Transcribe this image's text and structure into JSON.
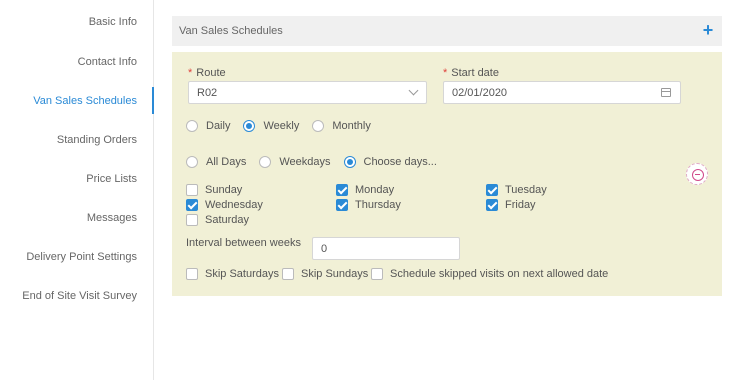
{
  "sidebar": {
    "items": [
      {
        "label": "Basic Info",
        "active": false
      },
      {
        "label": "Contact Info",
        "active": false
      },
      {
        "label": "Van Sales Schedules",
        "active": true
      },
      {
        "label": "Standing Orders",
        "active": false
      },
      {
        "label": "Price Lists",
        "active": false
      },
      {
        "label": "Messages",
        "active": false
      },
      {
        "label": "Delivery Point Settings",
        "active": false
      },
      {
        "label": "End of Site Visit Survey",
        "active": false
      }
    ]
  },
  "section": {
    "title": "Van Sales Schedules",
    "add_icon": "plus-icon",
    "add_symbol": "+"
  },
  "form": {
    "required_mark": "*",
    "route": {
      "label": "Route",
      "value": "R02"
    },
    "start_date": {
      "label": "Start date",
      "value": "02/01/2020"
    },
    "frequency": {
      "options": [
        "Daily",
        "Weekly",
        "Monthly"
      ],
      "selected": "Weekly"
    },
    "day_mode": {
      "options": [
        "All Days",
        "Weekdays",
        "Choose days..."
      ],
      "selected": "Choose days..."
    },
    "days": [
      {
        "label": "Sunday",
        "checked": false
      },
      {
        "label": "Monday",
        "checked": true
      },
      {
        "label": "Tuesday",
        "checked": true
      },
      {
        "label": "Wednesday",
        "checked": true
      },
      {
        "label": "Thursday",
        "checked": true
      },
      {
        "label": "Friday",
        "checked": true
      },
      {
        "label": "Saturday",
        "checked": false
      }
    ],
    "interval": {
      "label": "Interval between weeks",
      "value": "0"
    },
    "skip_options": [
      {
        "label": "Skip Saturdays",
        "checked": false
      },
      {
        "label": "Skip Sundays",
        "checked": false
      },
      {
        "label": "Schedule skipped visits on next allowed date",
        "checked": false
      }
    ],
    "remove_icon": "minus-circle-icon"
  },
  "colors": {
    "accent": "#2a8ad6",
    "panel_bg": "#f1f0d6",
    "header_bg": "#f0f0f0",
    "required": "#e0403a",
    "remove": "#d04a8a"
  }
}
